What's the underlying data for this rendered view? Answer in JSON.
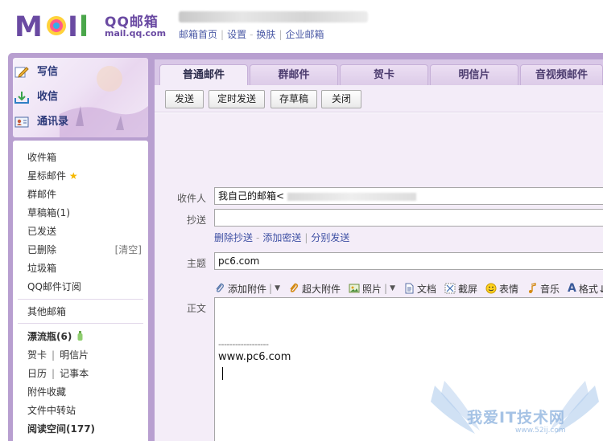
{
  "header": {
    "logo_text": "MoIL",
    "brand_title": "QQ邮箱",
    "brand_domain": "mail.qq.com",
    "links": [
      "邮箱首页",
      "设置",
      "换肤",
      "企业邮箱"
    ]
  },
  "sidebar": {
    "actions": [
      {
        "label": "写信",
        "icon": "pencil-icon"
      },
      {
        "label": "收信",
        "icon": "inbox-download-icon"
      },
      {
        "label": "通讯录",
        "icon": "contacts-card-icon"
      }
    ],
    "folders": [
      {
        "label": "收件箱"
      },
      {
        "label": "星标邮件",
        "icon": "star-icon"
      },
      {
        "label": "群邮件"
      },
      {
        "label": "草稿箱(1)"
      },
      {
        "label": "已发送"
      },
      {
        "label": "已删除",
        "extra": "[清空]"
      },
      {
        "label": "垃圾箱"
      },
      {
        "label": "QQ邮件订阅"
      }
    ],
    "other_mailbox": "其他邮箱",
    "bottle": {
      "label": "漂流瓶",
      "count": "(6)",
      "icon": "bottle-icon"
    },
    "greeting_card": "贺卡",
    "postcard": "明信片",
    "calendar": "日历",
    "notes": "记事本",
    "attachments": "附件收藏",
    "file_transfer": "文件中转站",
    "reading_space": {
      "label": "阅读空间",
      "count": "(177)"
    }
  },
  "tabs": [
    {
      "label": "普通邮件",
      "active": true
    },
    {
      "label": "群邮件",
      "active": false
    },
    {
      "label": "贺卡",
      "active": false
    },
    {
      "label": "明信片",
      "active": false
    },
    {
      "label": "音视频邮件",
      "active": false
    }
  ],
  "toolbar": {
    "send": "发送",
    "scheduled_send": "定时发送",
    "save_draft": "存草稿",
    "close": "关闭"
  },
  "compose": {
    "to_label": "收件人",
    "to_value": "我自己的邮箱",
    "to_value_bracket": "<",
    "cc_label": "抄送",
    "cc_value": "",
    "cc_links": [
      "删除抄送",
      "添加密送",
      "分别发送"
    ],
    "subject_label": "主题",
    "subject_value": "pc6.com",
    "body_label": "正文",
    "body_signature_line": "------------------",
    "body_text": "www.pc6.com",
    "tools": [
      {
        "label": "添加附件",
        "icon": "paperclip-icon",
        "dropdown": true
      },
      {
        "label": "超大附件",
        "icon": "paperclip-large-icon",
        "dropdown": false
      },
      {
        "label": "照片",
        "icon": "photo-icon",
        "dropdown": true
      },
      {
        "label": "文档",
        "icon": "document-icon",
        "dropdown": false
      },
      {
        "label": "截屏",
        "icon": "scissors-icon",
        "dropdown": false
      },
      {
        "label": "表情",
        "icon": "smiley-icon",
        "dropdown": false
      },
      {
        "label": "音乐",
        "icon": "music-note-icon",
        "dropdown": false
      },
      {
        "label": "格式↓",
        "icon": "font-format-icon",
        "dropdown": false
      }
    ]
  },
  "watermark": {
    "text": "我爱IT技术网",
    "url": "www.52ij.com"
  },
  "colors": {
    "frame_purple": "#b89fd0",
    "link_blue": "#3d4fa3",
    "logo_purple": "#6a4aa2"
  }
}
